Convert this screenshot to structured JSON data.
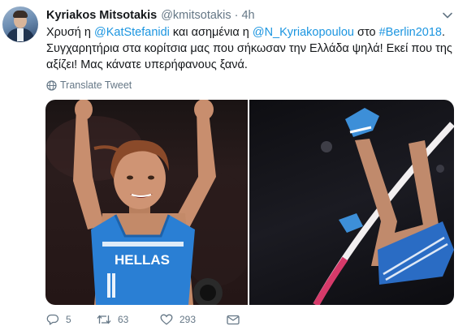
{
  "tweet": {
    "author_name": "Kyriakos Mitsotakis",
    "author_handle": "@kmitsotakis",
    "separator": "·",
    "time": "4h",
    "text": {
      "line1": {
        "a": "Χρυσή η ",
        "mention1": "@KatStefanidi",
        "b": " και ασημένια η ",
        "mention2": "@N_Kyriakopoulou",
        "c": " στο ",
        "hashtag": "#Berlin2018",
        "d": "."
      },
      "line2": "Συγχαρητήρια στα κορίτσια μας που σήκωσαν την Ελλάδα ψηλά! Εκεί που της",
      "line3": "αξίζει! Μας κάνατε υπερήφανους ξανά."
    },
    "translate_label": "Translate Tweet",
    "jersey_text": "HELLAS",
    "actions": {
      "replies": "5",
      "retweets": "63",
      "likes": "293"
    }
  },
  "colors": {
    "link": "#1b95e0",
    "secondary_text": "#657786",
    "primary_text": "#14171a",
    "jersey_blue": "#2a7fd4"
  },
  "icons": [
    "caret-down-icon",
    "globe-icon",
    "reply-icon",
    "retweet-icon",
    "heart-icon",
    "message-icon"
  ]
}
